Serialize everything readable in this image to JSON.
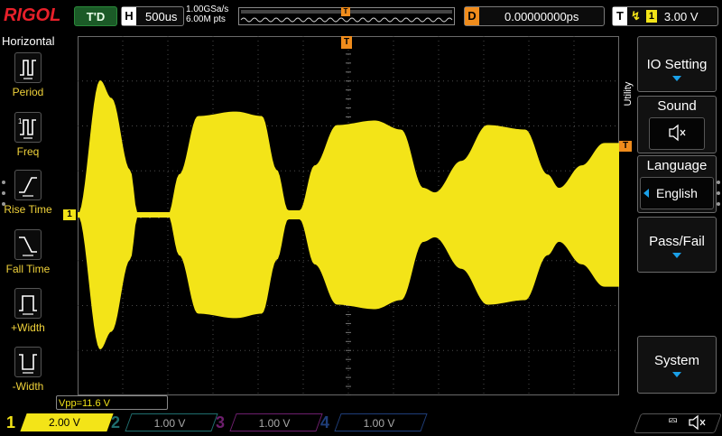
{
  "brand": "RIGOL",
  "top": {
    "run_status": "T'D",
    "timebase_key": "H",
    "timebase": "500us",
    "sample_rate": "1.00GSa/s",
    "memory_depth": "6.00M pts",
    "trigger_marker": "T",
    "delay_key": "D",
    "delay": "0.00000000ps",
    "trigger_key": "T",
    "trigger_channel": "1",
    "trigger_level": "3.00 V"
  },
  "left_menu": {
    "title": "Horizontal",
    "items": [
      {
        "label": "Period",
        "icon": "period-icon"
      },
      {
        "label": "Freq",
        "icon": "frequency-icon"
      },
      {
        "label": "Rise Time",
        "icon": "rise-time-icon"
      },
      {
        "label": "Fall Time",
        "icon": "fall-time-icon"
      },
      {
        "label": "+Width",
        "icon": "positive-width-icon"
      },
      {
        "label": "-Width",
        "icon": "negative-width-icon"
      }
    ]
  },
  "right_menu": {
    "tab_label": "Utility",
    "io_setting": "IO Setting",
    "sound": "Sound",
    "sound_icon": "speaker-muted-icon",
    "language": "Language",
    "language_value": "English",
    "pass_fail": "Pass/Fail",
    "system": "System"
  },
  "measurement": "Vpp=11.6 V",
  "channels": [
    {
      "num": "1",
      "scale": "2.00 V",
      "color": "#f3e418",
      "active": true
    },
    {
      "num": "2",
      "scale": "1.00 V",
      "color": "#17c4c4",
      "active": false
    },
    {
      "num": "3",
      "scale": "1.00 V",
      "color": "#e020e0",
      "active": false
    },
    {
      "num": "4",
      "scale": "1.00 V",
      "color": "#1a6de8",
      "active": false
    }
  ],
  "markers": {
    "ch1_offset": "1",
    "trigger_level_marker": "T"
  },
  "colors": {
    "ch1": "#f3e418",
    "trigger": "#f08c1c",
    "grid": "#4a4a4a",
    "accent_blue": "#1aa0e8"
  },
  "waveform": {
    "description": "amplitude-modulated burst signal",
    "envelope_divs": [
      [
        0.0,
        0.0
      ],
      [
        0.6,
        3.0
      ],
      [
        0.9,
        2.6
      ],
      [
        1.4,
        1.0
      ],
      [
        1.6,
        0.0
      ],
      [
        2.4,
        0.0
      ],
      [
        2.7,
        0.9
      ],
      [
        3.2,
        2.2
      ],
      [
        4.2,
        2.3
      ],
      [
        4.9,
        2.2
      ],
      [
        5.3,
        1.0
      ],
      [
        5.6,
        0.1
      ],
      [
        5.9,
        0.1
      ],
      [
        6.3,
        1.1
      ],
      [
        6.9,
        2.0
      ],
      [
        7.9,
        2.1
      ],
      [
        8.6,
        1.9
      ],
      [
        9.2,
        0.6
      ],
      [
        9.5,
        0.5
      ],
      [
        10.2,
        1.2
      ],
      [
        10.9,
        2.0
      ],
      [
        11.9,
        1.9
      ],
      [
        12.5,
        0.9
      ],
      [
        12.8,
        0.6
      ],
      [
        13.4,
        1.1
      ],
      [
        14.0,
        1.6
      ]
    ]
  }
}
